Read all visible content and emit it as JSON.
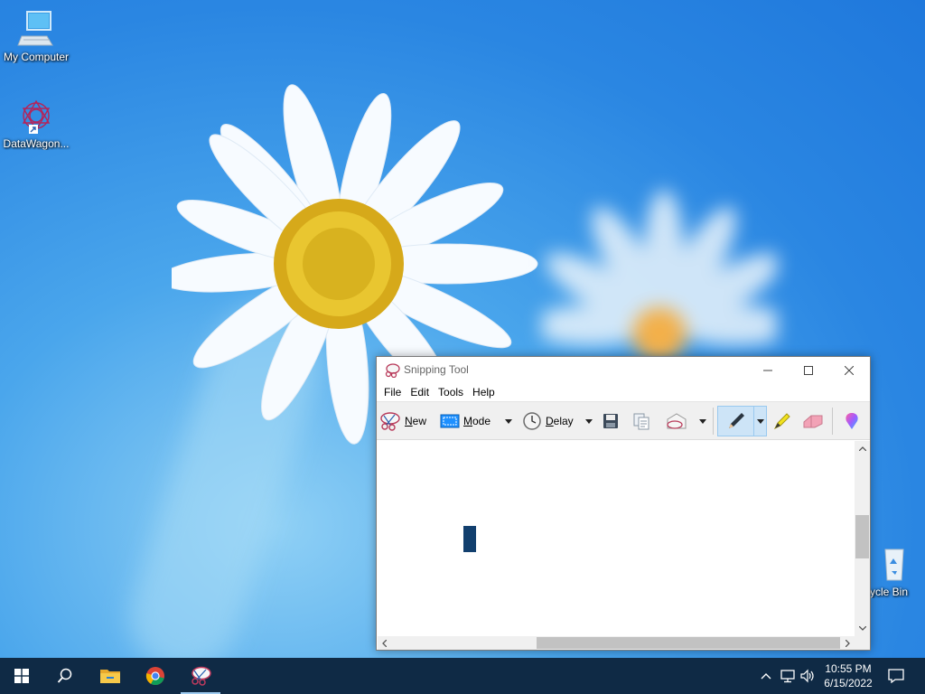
{
  "desktop": {
    "icons": [
      {
        "label": "My Computer",
        "icon": "computer-icon"
      },
      {
        "label": "DataWagon...",
        "icon": "datawagon-icon"
      },
      {
        "label": "ycle Bin",
        "icon": "recycle-bin-icon"
      }
    ]
  },
  "snipping_tool": {
    "title": "Snipping Tool",
    "menu": [
      "File",
      "Edit",
      "Tools",
      "Help"
    ],
    "toolbar": {
      "new": {
        "label": "New",
        "icon": "scissors-icon"
      },
      "mode": {
        "label": "Mode",
        "icon": "rectangle-snip-icon"
      },
      "delay": {
        "label": "Delay",
        "icon": "clock-icon"
      },
      "save_icon": "save-icon",
      "copy_icon": "copy-icon",
      "send_icon": "send-email-icon",
      "pen_icon": "pen-icon",
      "highlighter_icon": "highlighter-icon",
      "eraser_icon": "eraser-icon",
      "paint3d_icon": "paint3d-icon"
    }
  },
  "taskbar": {
    "apps": [
      "start-icon",
      "search-icon",
      "file-explorer-icon",
      "chrome-icon",
      "snipping-tool-icon"
    ],
    "clock": {
      "time": "10:55 PM",
      "date": "6/15/2022"
    }
  },
  "colors": {
    "taskbar": "#0f2a45",
    "wallpaper": "#2a86e2",
    "pen_selected": "#cde4f7"
  }
}
